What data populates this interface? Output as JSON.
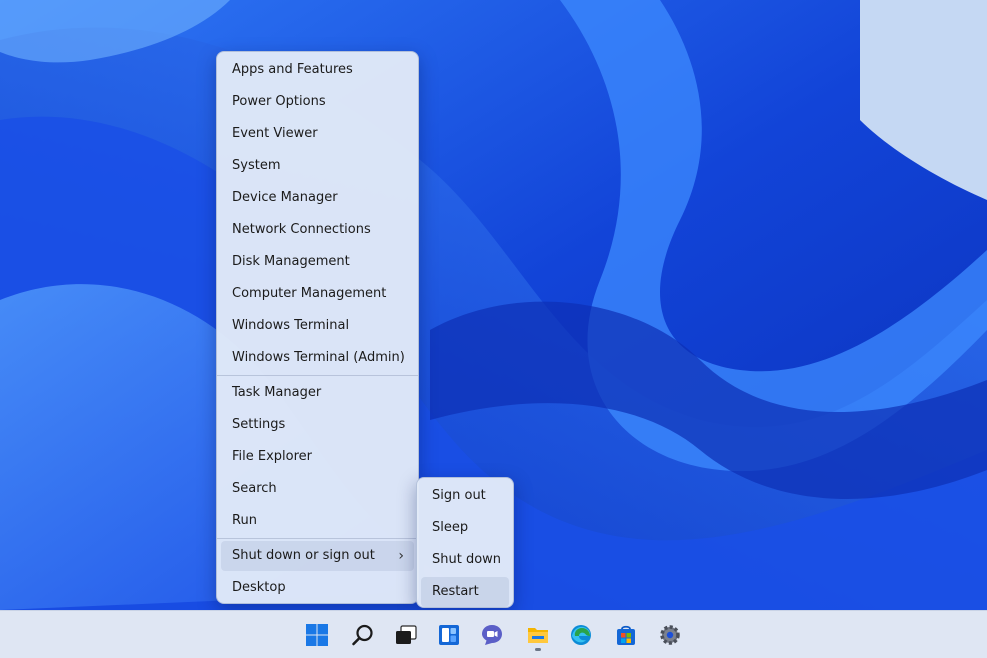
{
  "context_menu": {
    "items": [
      {
        "label": "Apps and Features"
      },
      {
        "label": "Power Options"
      },
      {
        "label": "Event Viewer"
      },
      {
        "label": "System"
      },
      {
        "label": "Device Manager"
      },
      {
        "label": "Network Connections"
      },
      {
        "label": "Disk Management"
      },
      {
        "label": "Computer Management"
      },
      {
        "label": "Windows Terminal"
      },
      {
        "label": "Windows Terminal (Admin)"
      },
      {
        "label": "Task Manager"
      },
      {
        "label": "Settings"
      },
      {
        "label": "File Explorer"
      },
      {
        "label": "Search"
      },
      {
        "label": "Run"
      },
      {
        "label": "Shut down or sign out",
        "chevron": "›"
      },
      {
        "label": "Desktop"
      }
    ]
  },
  "shutdown_submenu": {
    "items": [
      {
        "label": "Sign out"
      },
      {
        "label": "Sleep"
      },
      {
        "label": "Shut down"
      },
      {
        "label": "Restart"
      }
    ]
  },
  "taskbar": {
    "icons": [
      "windows-start-icon",
      "search-icon",
      "task-view-icon",
      "widgets-icon",
      "teams-chat-icon",
      "file-explorer-icon",
      "edge-browser-icon",
      "microsoft-store-icon",
      "settings-gear-icon"
    ]
  },
  "colors": {
    "wallpaper_blue": "#1f5cf2",
    "menu_bg": "#e2eaf8",
    "taskbar_bg": "#dfe6f3"
  }
}
